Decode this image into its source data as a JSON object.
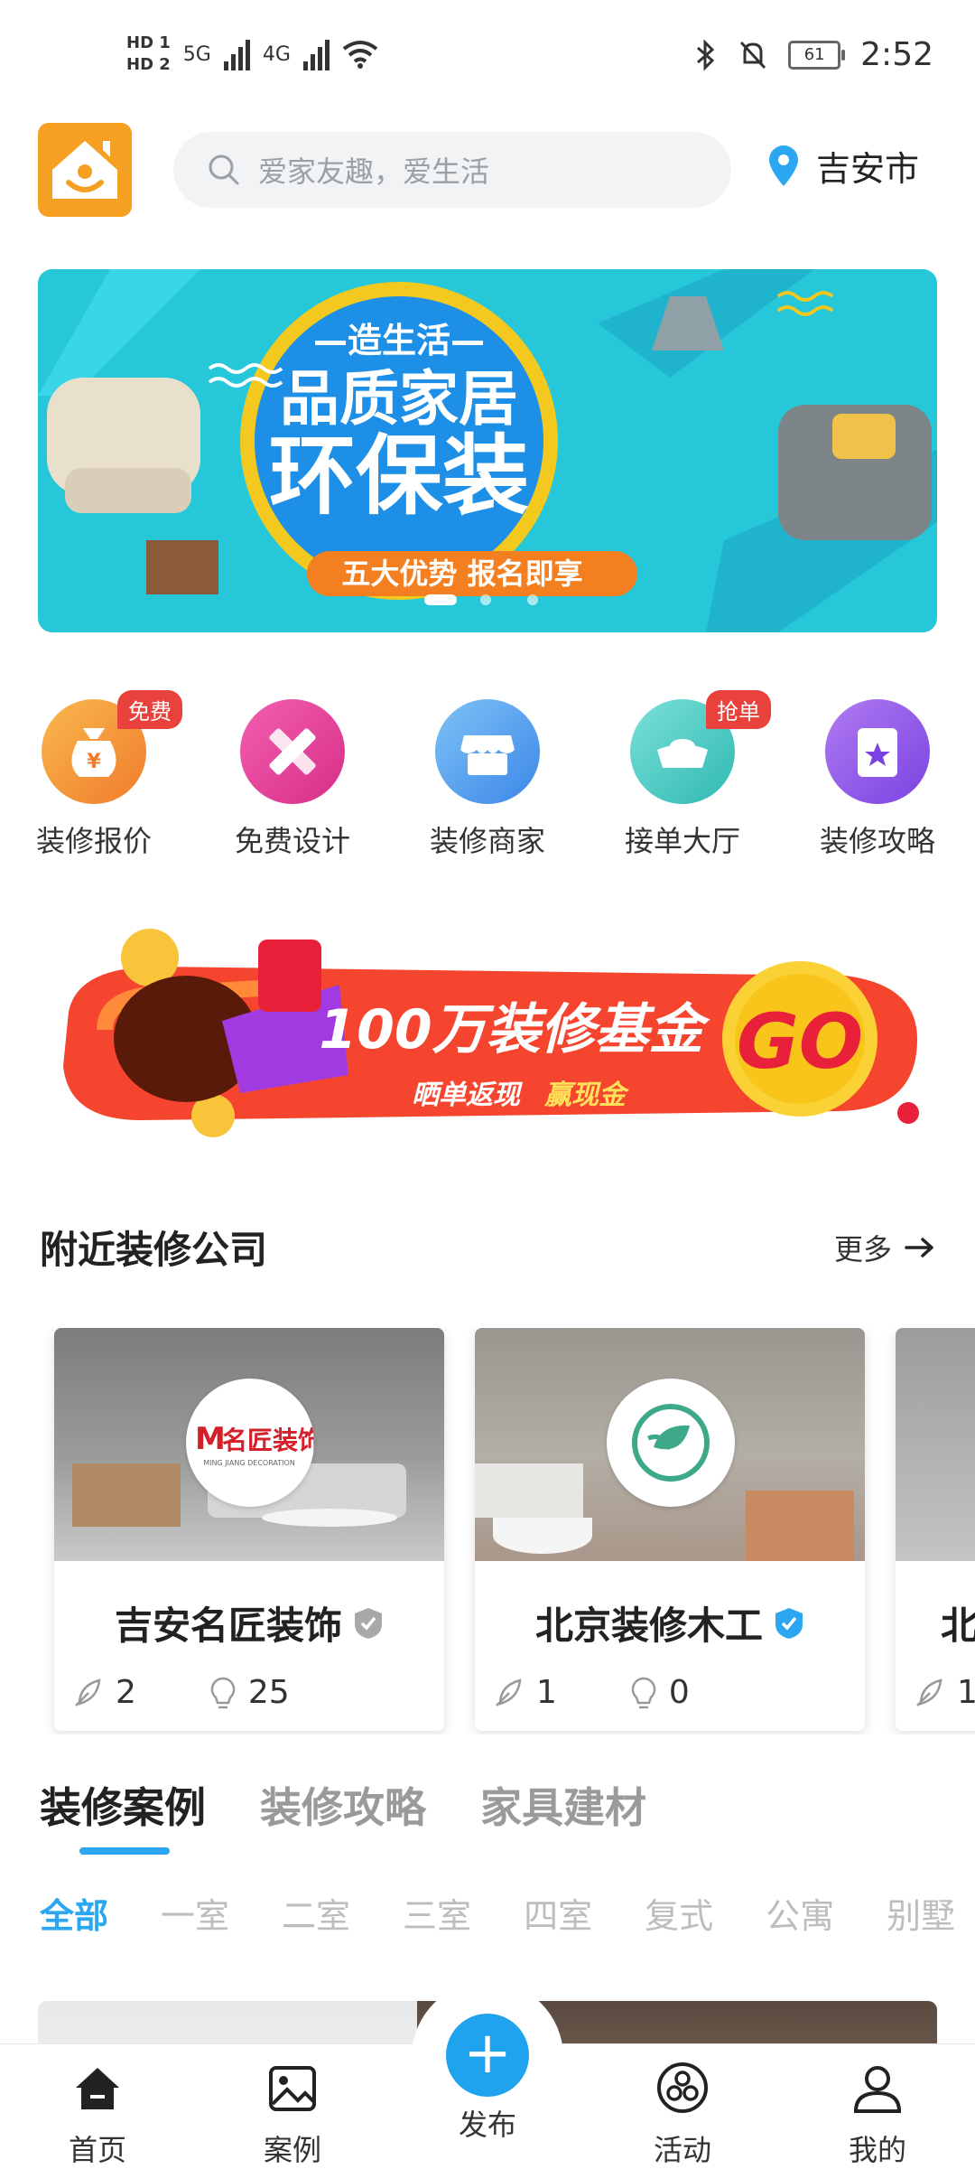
{
  "status_bar": {
    "hd1": "HD 1",
    "hd2": "HD 2",
    "net1": "5G",
    "net2": "4G",
    "battery": "61",
    "time": "2:52"
  },
  "header": {
    "search_placeholder": "爱家友趣，爱生活",
    "location": "吉安市"
  },
  "banner": {
    "line1": "—造生活—",
    "line2": "品质家居",
    "line3": "环保装",
    "tagline": "五大优势 报名即享"
  },
  "quick_actions": [
    {
      "label": "装修报价",
      "badge": "免费",
      "color": "#f59a3a",
      "icon": "money-bag-icon"
    },
    {
      "label": "免费设计",
      "badge": "",
      "color": "#e8439b",
      "icon": "ruler-pencil-icon"
    },
    {
      "label": "装修商家",
      "badge": "",
      "color": "#4a9ff0",
      "icon": "store-icon"
    },
    {
      "label": "接单大厅",
      "badge": "抢单",
      "color": "#40c9c2",
      "icon": "ingot-icon"
    },
    {
      "label": "装修攻略",
      "badge": "",
      "color": "#8a55e6",
      "icon": "star-book-icon"
    }
  ],
  "promo": {
    "title": "100万装修基金",
    "subtitle_a": "晒单返现",
    "subtitle_b": "赢现金",
    "go": "GO"
  },
  "nearby": {
    "title": "附近装修公司",
    "more": "更多",
    "companies": [
      {
        "name": "吉安名匠装饰",
        "logo_text": "名匠装饰",
        "logo_sub": "MING JIANG DECORATION",
        "verified_color": "#a8a8a8",
        "likes": "2",
        "ideas": "25"
      },
      {
        "name": "北京装修木工",
        "logo_text": "",
        "logo_sub": "",
        "verified_color": "#2aa7f0",
        "likes": "1",
        "ideas": "0"
      },
      {
        "name": "北",
        "logo_text": "",
        "logo_sub": "",
        "verified_color": "#2aa7f0",
        "likes": "1",
        "ideas": ""
      }
    ]
  },
  "content_tabs": [
    "装修案例",
    "装修攻略",
    "家具建材"
  ],
  "room_filters": [
    "全部",
    "一室",
    "二室",
    "三室",
    "四室",
    "复式",
    "公寓",
    "别墅"
  ],
  "bottom_nav": [
    {
      "label": "首页",
      "icon": "home-icon"
    },
    {
      "label": "案例",
      "icon": "image-icon"
    },
    {
      "label": "发布",
      "icon": "plus-icon"
    },
    {
      "label": "活动",
      "icon": "activity-icon"
    },
    {
      "label": "我的",
      "icon": "profile-icon"
    }
  ]
}
